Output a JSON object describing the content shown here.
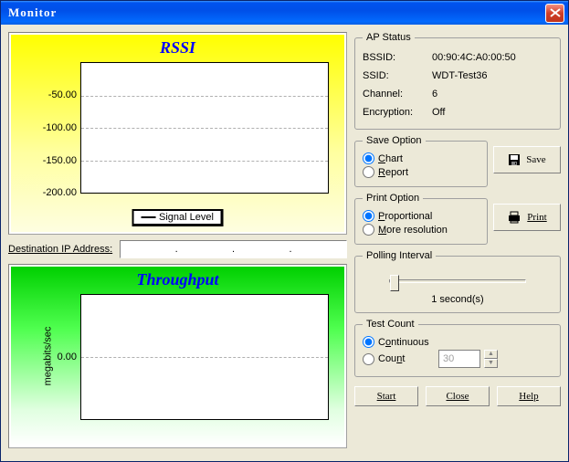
{
  "window": {
    "title": "Monitor"
  },
  "rssi": {
    "title": "RSSI",
    "legend": "Signal Level",
    "ylabels": [
      "-50.00",
      "-100.00",
      "-150.00",
      "-200.00"
    ]
  },
  "destination": {
    "label": "Destination IP Address:",
    "dots": [
      ".",
      ".",
      "."
    ]
  },
  "throughput": {
    "title": "Throughput",
    "ylabel": "megabits/sec",
    "ytick": "0.00"
  },
  "ap_status": {
    "legend": "AP Status",
    "bssid_label": "BSSID:",
    "bssid_value": "00:90:4C:A0:00:50",
    "ssid_label": "SSID:",
    "ssid_value": "WDT-Test36",
    "channel_label": "Channel:",
    "channel_value": "6",
    "encryption_label": "Encryption:",
    "encryption_value": "Off"
  },
  "save_option": {
    "legend": "Save Option",
    "chart": "Chart",
    "report": "Report"
  },
  "print_option": {
    "legend": "Print Option",
    "proportional": "Proportional",
    "more_res": "More resolution"
  },
  "polling": {
    "legend": "Polling Interval",
    "value": "1 second(s)"
  },
  "test_count": {
    "legend": "Test Count",
    "continuous": "Continuous",
    "count": "Count",
    "count_value": "30"
  },
  "buttons": {
    "save": "Save",
    "print": "Print",
    "start": "Start",
    "close": "Close",
    "help": "Help"
  },
  "chart_data": [
    {
      "type": "line",
      "title": "RSSI",
      "ylabel": "",
      "series": [
        {
          "name": "Signal Level",
          "values": []
        }
      ],
      "ylim": [
        -200,
        0
      ],
      "yticks": [
        -50,
        -100,
        -150,
        -200
      ]
    },
    {
      "type": "line",
      "title": "Throughput",
      "ylabel": "megabits/sec",
      "series": [
        {
          "name": "Throughput",
          "values": []
        }
      ],
      "yticks": [
        0
      ]
    }
  ]
}
